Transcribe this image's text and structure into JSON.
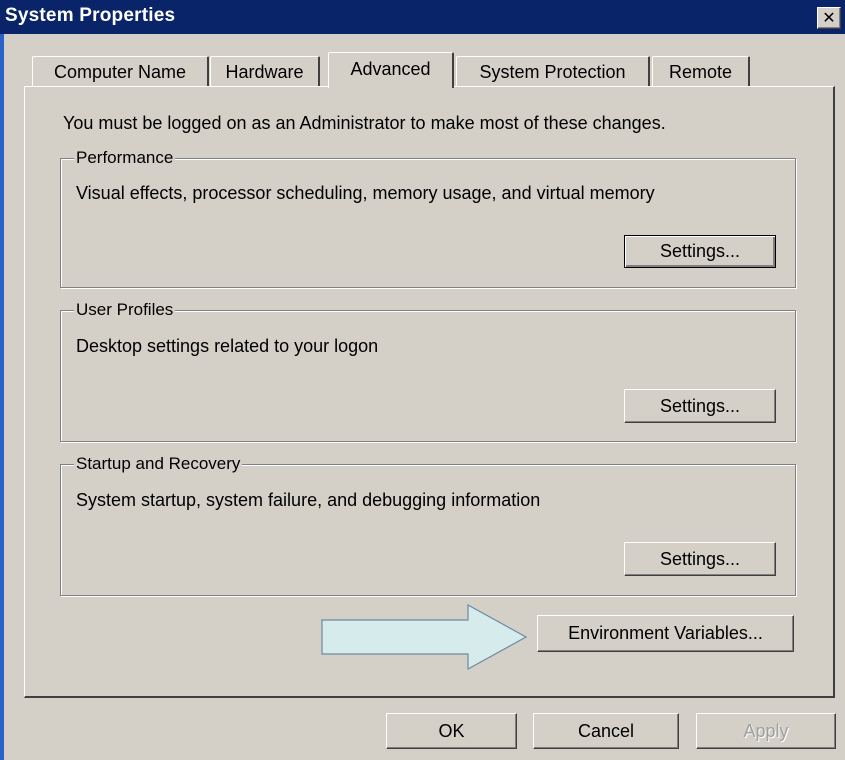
{
  "window": {
    "title": "System Properties",
    "close_glyph": "✕"
  },
  "tabs": [
    {
      "label": "Computer Name"
    },
    {
      "label": "Hardware"
    },
    {
      "label": "Advanced",
      "selected": true
    },
    {
      "label": "System Protection"
    },
    {
      "label": "Remote"
    }
  ],
  "advanced": {
    "admin_note": "You must be logged on as an Administrator to make most of these changes.",
    "performance": {
      "label": "Performance",
      "description": "Visual effects, processor scheduling, memory usage, and virtual memory",
      "button": "Settings..."
    },
    "user_profiles": {
      "label": "User Profiles",
      "description": "Desktop settings related to your logon",
      "button": "Settings..."
    },
    "startup_recovery": {
      "label": "Startup and Recovery",
      "description": "System startup, system failure, and debugging information",
      "button": "Settings..."
    },
    "env_button": "Environment Variables...",
    "arrow_color": "#d6ecec"
  },
  "footer": {
    "ok": "OK",
    "cancel": "Cancel",
    "apply": "Apply",
    "apply_enabled": false
  },
  "colors": {
    "titlebar": "#0a246a",
    "face": "#d4d0c8"
  }
}
